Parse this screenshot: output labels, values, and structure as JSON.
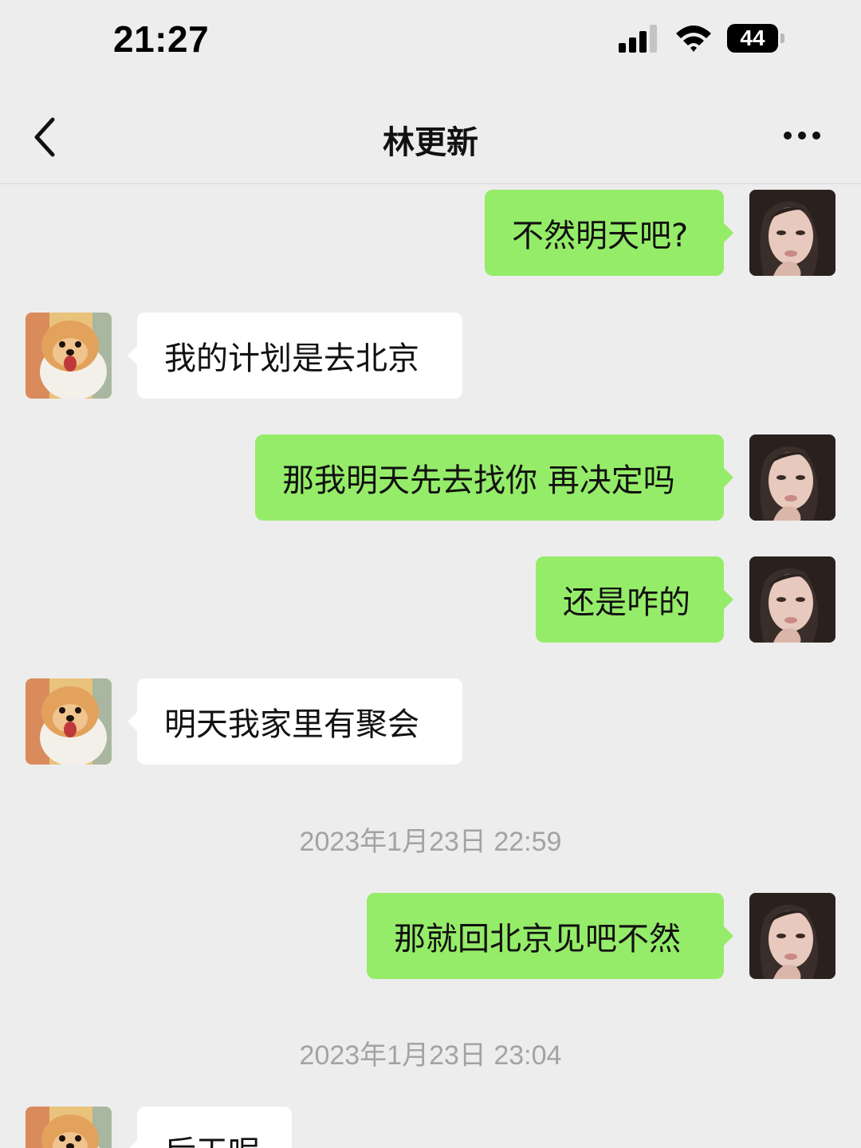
{
  "status_bar": {
    "time": "21:27",
    "battery": "44",
    "icons": [
      "cellular-signal-icon",
      "wifi-icon",
      "battery-icon"
    ]
  },
  "nav": {
    "title": "林更新",
    "back_icon": "chevron-left-icon",
    "more_icon": "more-dots-icon"
  },
  "colors": {
    "outgoing_bubble": "#95ec69",
    "incoming_bubble": "#ffffff",
    "background": "#ededed",
    "timestamp_text": "#a3a3a3"
  },
  "messages": [
    {
      "sender": "me",
      "text": "不然明天吧?"
    },
    {
      "sender": "contact",
      "text": "我的计划是去北京"
    },
    {
      "sender": "me",
      "text": "那我明天先去找你 再决定吗"
    },
    {
      "sender": "me",
      "text": "还是咋的"
    },
    {
      "sender": "contact",
      "text": "明天我家里有聚会"
    },
    {
      "type": "timestamp",
      "text": "2023年1月23日 22:59"
    },
    {
      "sender": "me",
      "text": "那就回北京见吧不然"
    },
    {
      "type": "timestamp",
      "text": "2023年1月23日 23:04"
    },
    {
      "sender": "contact",
      "text": "后天呢"
    }
  ]
}
